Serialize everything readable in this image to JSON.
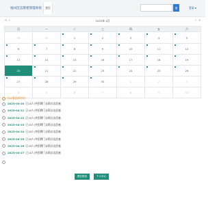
{
  "header": {
    "brand": "福州区志愿者管理系统",
    "nav_tab": "首页",
    "search_placeholder": "",
    "search_button": "搜",
    "login": "登录"
  },
  "calendar": {
    "title": "2025年 4月",
    "prev": "«",
    "prev2": "‹",
    "next": "›",
    "next2": "»",
    "weekdays": [
      "日",
      "一",
      "二",
      "三",
      "四",
      "五",
      "六"
    ],
    "weeks": [
      [
        {
          "d": "30",
          "o": true
        },
        {
          "d": "31",
          "o": true
        },
        {
          "d": "1",
          "e": true
        },
        {
          "d": "2",
          "e": true
        },
        {
          "d": "3",
          "e": true
        },
        {
          "d": "4",
          "e": true
        },
        {
          "d": "5",
          "e": true
        }
      ],
      [
        {
          "d": "6",
          "e": true
        },
        {
          "d": "7",
          "e": true
        },
        {
          "d": "8",
          "e": true
        },
        {
          "d": "9",
          "e": true
        },
        {
          "d": "10",
          "e": true
        },
        {
          "d": "11",
          "e": true
        },
        {
          "d": "12",
          "e": true
        }
      ],
      [
        {
          "d": "13",
          "e": true
        },
        {
          "d": "14",
          "e": true
        },
        {
          "d": "15",
          "e": true
        },
        {
          "d": "16",
          "e": true
        },
        {
          "d": "17",
          "e": true
        },
        {
          "d": "18",
          "e": true
        },
        {
          "d": "19",
          "e": true
        }
      ],
      [
        {
          "d": "20",
          "t": true
        },
        {
          "d": "21",
          "e": true
        },
        {
          "d": "22",
          "e": true
        },
        {
          "d": "23",
          "e": true
        },
        {
          "d": "24",
          "e": true
        },
        {
          "d": "25",
          "e": true
        },
        {
          "d": "26",
          "e": true
        }
      ],
      [
        {
          "d": "27",
          "e": true
        },
        {
          "d": "28",
          "e": true
        },
        {
          "d": "29",
          "e": true
        },
        {
          "d": "30",
          "e": true
        },
        {
          "d": "1",
          "o": true
        },
        {
          "d": "2",
          "o": true
        },
        {
          "d": "3",
          "o": true
        }
      ],
      [
        {
          "d": "4",
          "o": true
        },
        {
          "d": "5",
          "o": true
        },
        {
          "d": "6",
          "o": true
        },
        {
          "d": "7",
          "o": true
        },
        {
          "d": "8",
          "o": true
        },
        {
          "d": "9",
          "o": true
        },
        {
          "d": "10",
          "o": true
        }
      ]
    ]
  },
  "events": {
    "title": "可以报名的时间：",
    "items": [
      {
        "date": "2025-04-20",
        "desc": "已18人/共招聘门诊帮诊志愿者"
      },
      {
        "date": "2025-04-21",
        "desc": "已18人/共招聘门诊帮诊志愿者"
      },
      {
        "date": "2025-04-22",
        "desc": "已18人/共招聘门诊帮诊志愿者"
      },
      {
        "date": "2025-04-23",
        "desc": "已18人/共招聘门诊帮诊志愿者"
      },
      {
        "date": "2025-04-24",
        "desc": "已18人/共招聘门诊帮诊志愿者"
      },
      {
        "date": "2025-04-25",
        "desc": "已18人/共招聘门诊帮诊志愿者"
      },
      {
        "date": "2025-04-26",
        "desc": "已18人/共招聘门诊帮诊志愿者"
      },
      {
        "date": "2025-04-27",
        "desc": "已18人/共招聘门诊帮诊志愿者"
      }
    ]
  },
  "actions": {
    "submit": "提交报名",
    "personal": "个人中心"
  },
  "colors": {
    "accent": "#1f8f7a",
    "brand": "#3d6fa8",
    "warning": "#e48a1d",
    "button_blue": "#2b7bd3"
  }
}
